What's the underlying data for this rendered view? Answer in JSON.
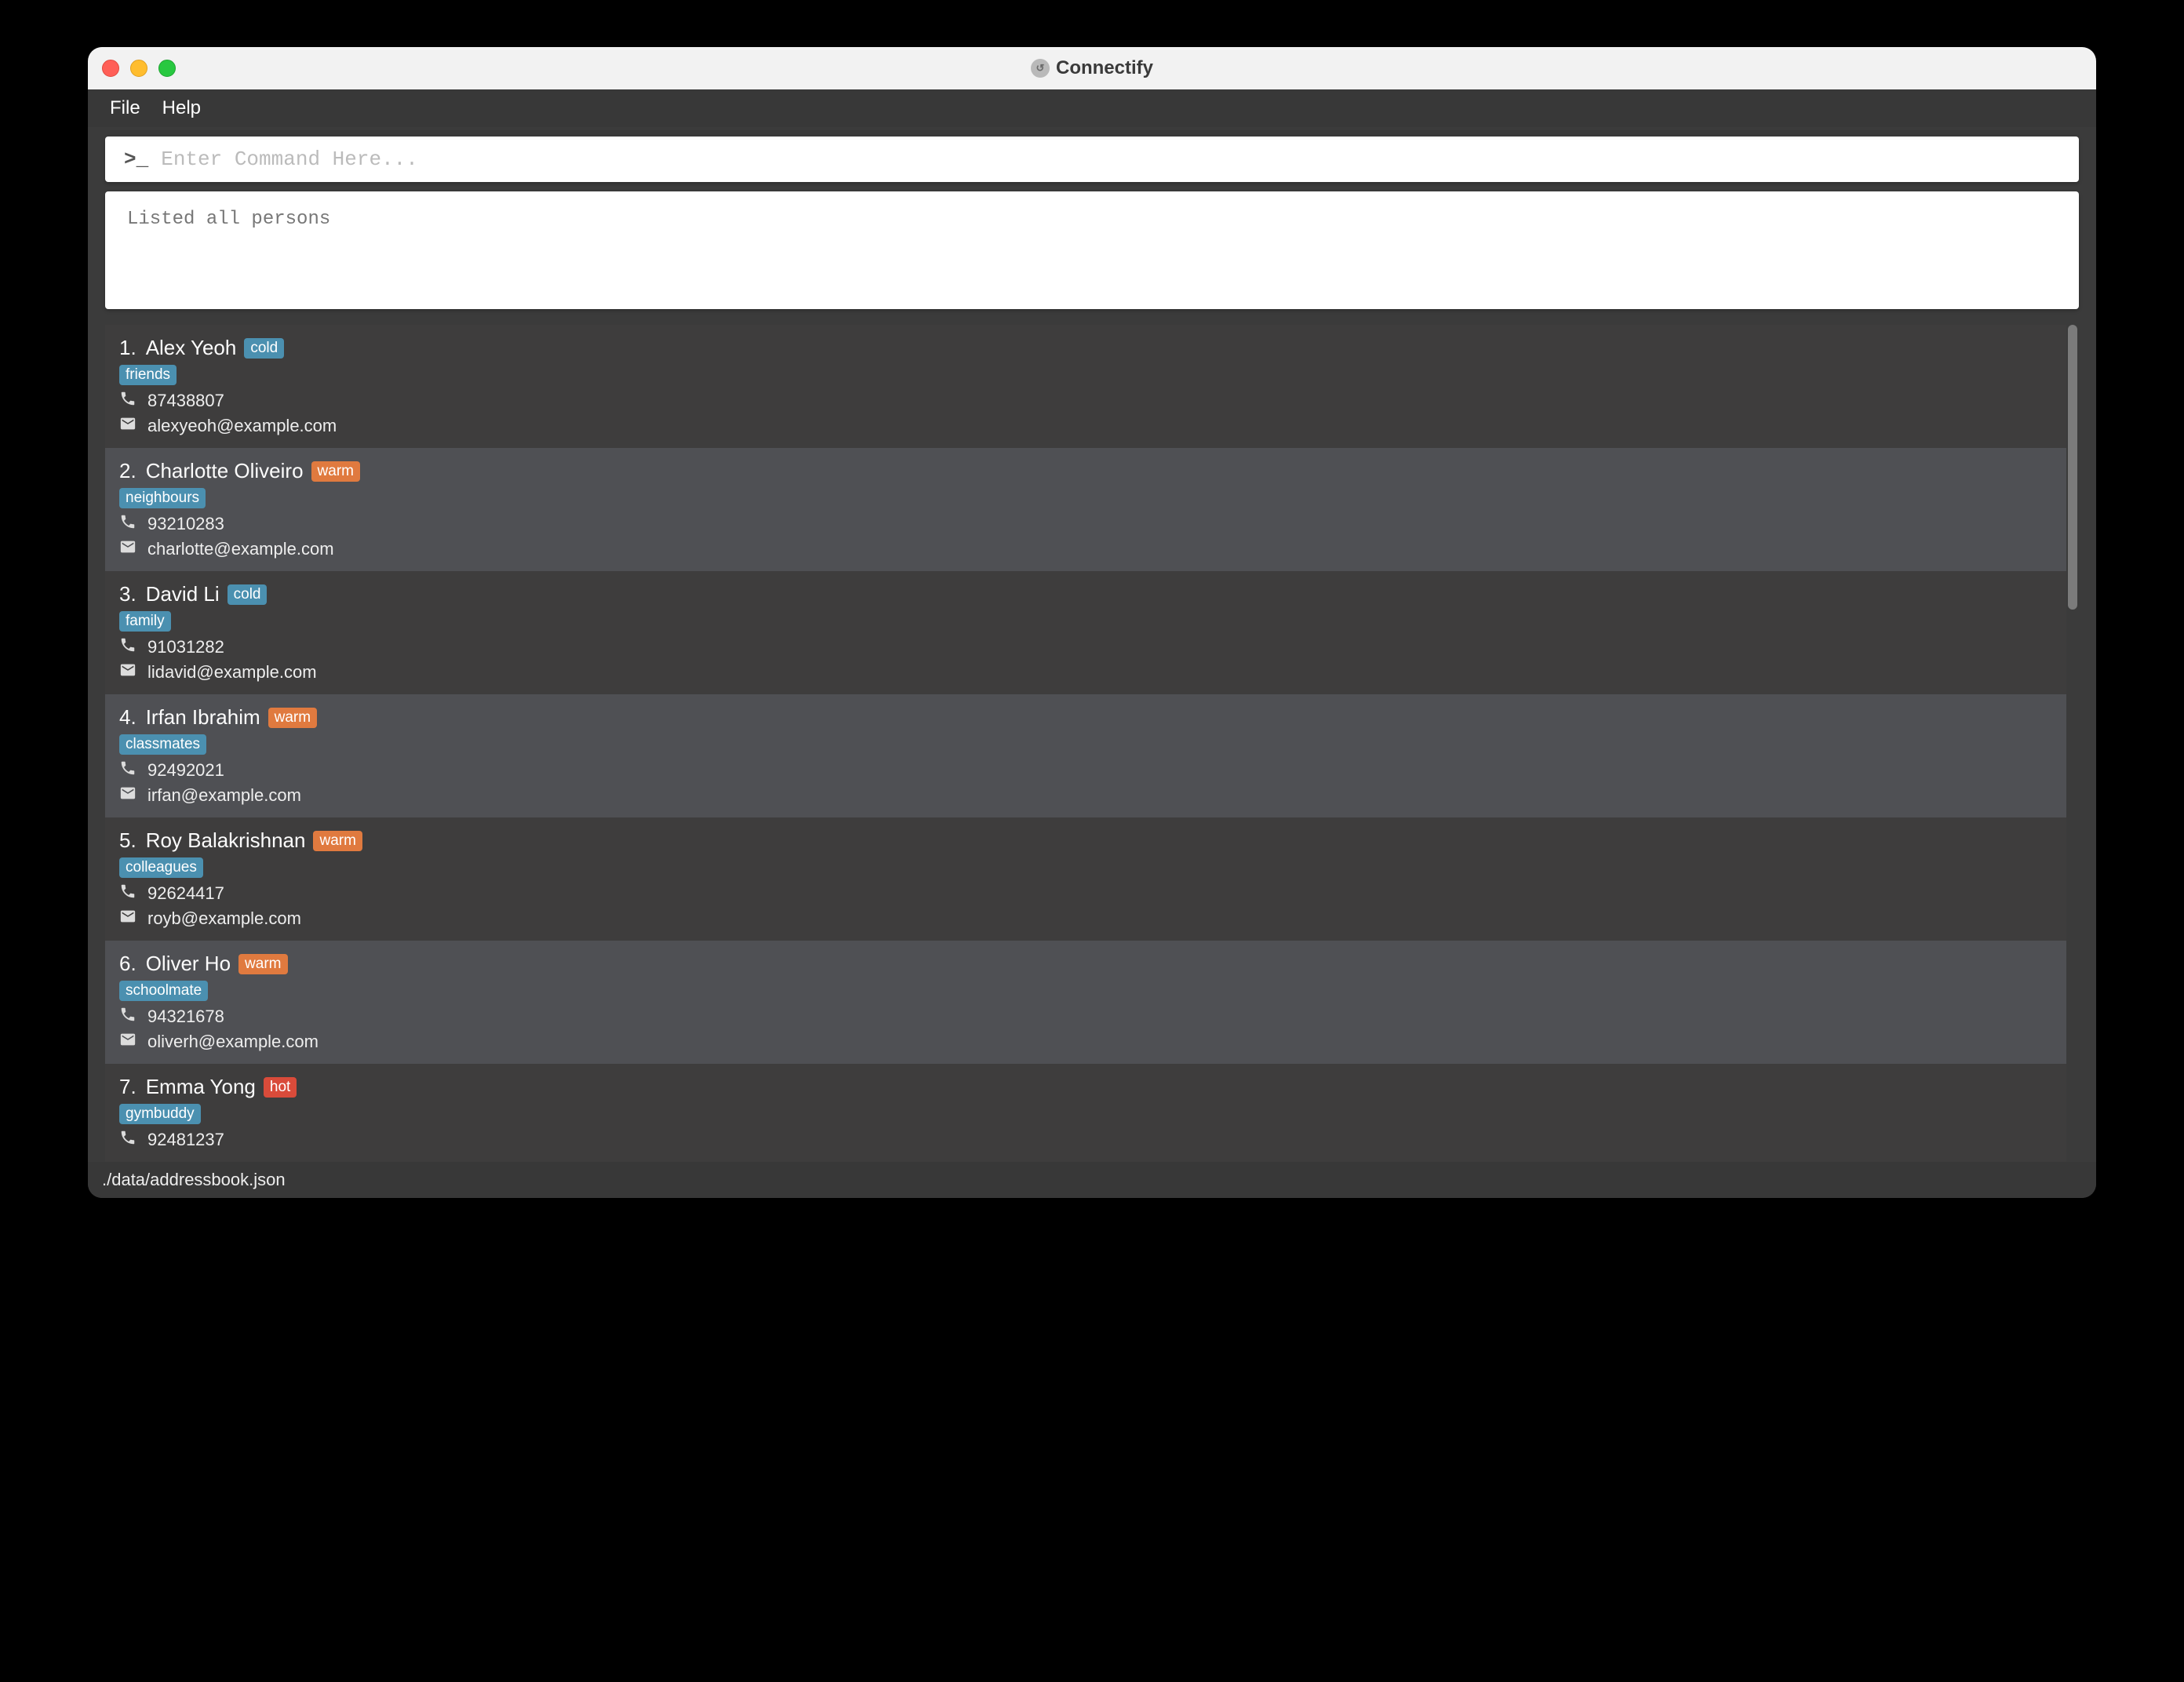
{
  "window": {
    "title": "Connectify"
  },
  "menu": {
    "file": "File",
    "help": "Help"
  },
  "command": {
    "placeholder": "Enter Command Here...",
    "value": ""
  },
  "result": {
    "text": "Listed all persons"
  },
  "status_colors": {
    "cold": "#4b90b0",
    "warm": "#e07a3f",
    "hot": "#d94b3a"
  },
  "persons": [
    {
      "idx": "1.",
      "name": "Alex Yeoh",
      "status": "cold",
      "tags": [
        "friends"
      ],
      "phone": "87438807",
      "email": "alexyeoh@example.com"
    },
    {
      "idx": "2.",
      "name": "Charlotte Oliveiro",
      "status": "warm",
      "tags": [
        "neighbours"
      ],
      "phone": "93210283",
      "email": "charlotte@example.com"
    },
    {
      "idx": "3.",
      "name": "David Li",
      "status": "cold",
      "tags": [
        "family"
      ],
      "phone": "91031282",
      "email": "lidavid@example.com"
    },
    {
      "idx": "4.",
      "name": "Irfan Ibrahim",
      "status": "warm",
      "tags": [
        "classmates"
      ],
      "phone": "92492021",
      "email": "irfan@example.com"
    },
    {
      "idx": "5.",
      "name": "Roy Balakrishnan",
      "status": "warm",
      "tags": [
        "colleagues"
      ],
      "phone": "92624417",
      "email": "royb@example.com"
    },
    {
      "idx": "6.",
      "name": "Oliver Ho",
      "status": "warm",
      "tags": [
        "schoolmate"
      ],
      "phone": "94321678",
      "email": "oliverh@example.com"
    },
    {
      "idx": "7.",
      "name": "Emma Yong",
      "status": "hot",
      "tags": [
        "gymbuddy"
      ],
      "phone": "92481237",
      "email": ""
    }
  ],
  "statusbar": {
    "path": "./data/addressbook.json"
  }
}
